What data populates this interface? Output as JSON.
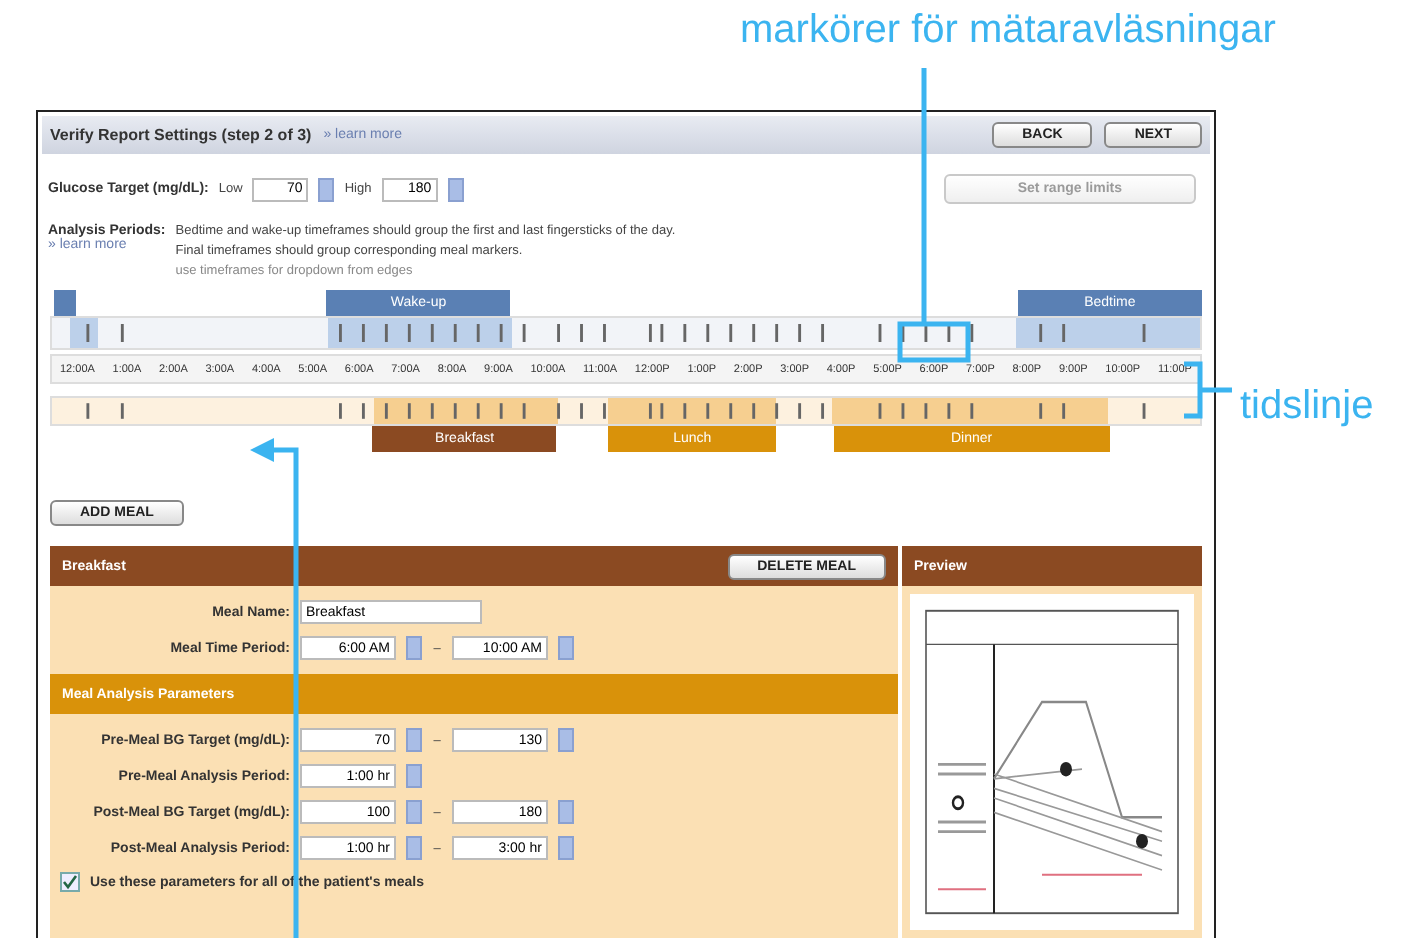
{
  "annotations": {
    "markers": "markörer för mätaravläsningar",
    "timeline": "tidslinje"
  },
  "header": {
    "title": "Verify Report Settings (step 2 of 3)",
    "help_link": "» learn more",
    "buttons": [
      {
        "label": "BACK"
      },
      {
        "label": "NEXT"
      }
    ]
  },
  "glucose_target": {
    "label": "Glucose Target (mg/dL):",
    "low_label": "Low",
    "low": "70",
    "high_label": "High",
    "high": "180",
    "button": {
      "label": "Set range limits",
      "disabled": true
    }
  },
  "analysis_periods": {
    "label": "Analysis Periods:",
    "help_link": "» learn more",
    "notes": [
      "Bedtime and wake-up timeframes should group the first and last fingersticks of the day.",
      "Final timeframes should group corresponding meal markers."
    ],
    "hint": "use timeframes for dropdown from edges"
  },
  "periods": [
    {
      "label": "Wake-up"
    },
    {
      "label": "Bedtime"
    }
  ],
  "timeline": {
    "ticks": [
      "12:00A",
      "1:00A",
      "2:00A",
      "3:00A",
      "4:00A",
      "5:00A",
      "6:00A",
      "7:00A",
      "8:00A",
      "9:00A",
      "10:00A",
      "11:00A",
      "12:00P",
      "1:00P",
      "2:00P",
      "3:00P",
      "4:00P",
      "5:00P",
      "6:00P",
      "7:00P",
      "8:00P",
      "9:00P",
      "10:00P",
      "11:00P"
    ]
  },
  "meals": [
    {
      "label": "Breakfast",
      "selected": true
    },
    {
      "label": "Lunch",
      "selected": false
    },
    {
      "label": "Dinner",
      "selected": false
    }
  ],
  "add_meal": "ADD MEAL",
  "meal_panel": {
    "title": "Breakfast",
    "delete": "DELETE MEAL",
    "name_label": "Meal Name:",
    "name": "Breakfast",
    "time_label": "Meal Time Period:",
    "time_from": "6:00 AM",
    "time_sep": "–",
    "time_to": "10:00 AM",
    "params_title": "Meal Analysis Parameters",
    "params": [
      {
        "label": "Pre-Meal BG Target (mg/dL):",
        "from": "70",
        "sep": "–",
        "to": "130"
      },
      {
        "label": "Pre-Meal Analysis Period:",
        "from": "1:00 hr"
      },
      {
        "label": "Post-Meal BG Target (mg/dL):",
        "from": "100",
        "sep": "–",
        "to": "180"
      },
      {
        "label": "Post-Meal Analysis Period:",
        "from": "1:00 hr",
        "sep": "–",
        "to": "3:00 hr"
      }
    ],
    "apply_all": {
      "label": "Use these parameters for all of the patient's meals",
      "checked": true
    }
  },
  "preview": {
    "title": "Preview"
  }
}
